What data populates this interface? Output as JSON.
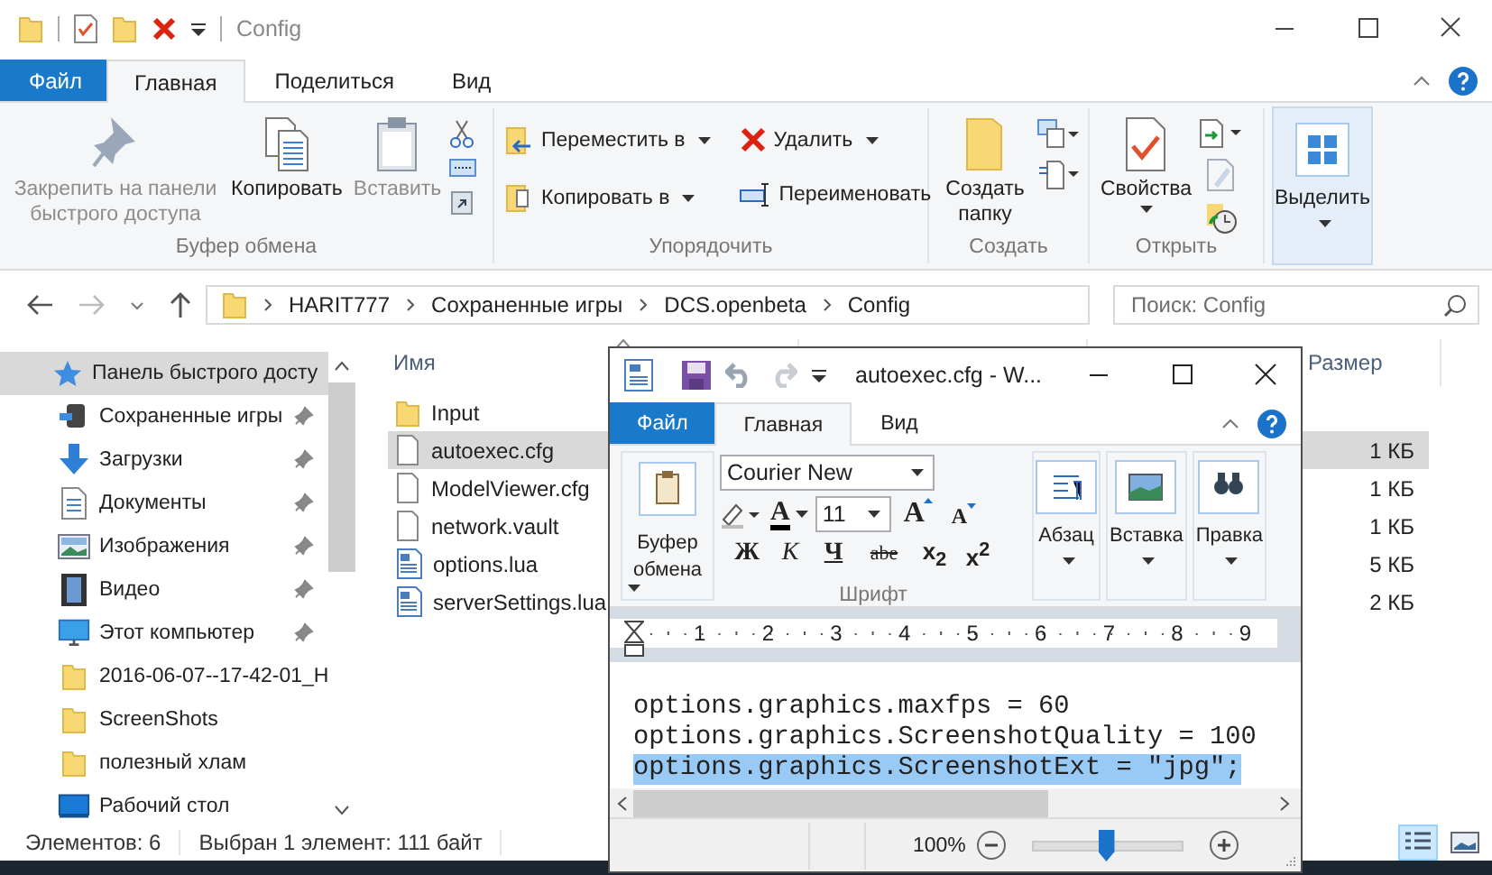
{
  "explorer": {
    "title": "Config",
    "tabs": [
      {
        "label": "Файл",
        "kind": "file",
        "selected": false
      },
      {
        "label": "Главная",
        "kind": "tab",
        "selected": true
      },
      {
        "label": "Поделиться",
        "kind": "tab",
        "selected": false
      },
      {
        "label": "Вид",
        "kind": "tab",
        "selected": false
      }
    ],
    "ribbon_groups": [
      {
        "label": "Буфер обмена",
        "buttons": [
          {
            "label": "Закрепить на панели быстрого доступа",
            "disabled": true
          },
          {
            "label": "Копировать",
            "disabled": false
          },
          {
            "label": "Вставить",
            "disabled": true
          }
        ]
      },
      {
        "label": "Упорядочить",
        "buttons": [
          {
            "label": "Переместить в",
            "dropdown": true
          },
          {
            "label": "Копировать в",
            "dropdown": true
          },
          {
            "label": "Удалить",
            "dropdown": true
          },
          {
            "label": "Переименовать",
            "dropdown": false
          }
        ]
      },
      {
        "label": "Создать",
        "buttons": [
          {
            "label": "Создать папку",
            "dropdown": false
          }
        ]
      },
      {
        "label": "Открыть",
        "buttons": [
          {
            "label": "Свойства",
            "dropdown": true
          }
        ]
      }
    ],
    "select_button": {
      "label": "Выделить",
      "dropdown": true
    },
    "breadcrumbs": [
      "HARIT777",
      "Сохраненные игры",
      "DCS.openbeta",
      "Config"
    ],
    "search": {
      "placeholder": "Поиск: Config"
    },
    "navigation": {
      "label": "Панель быстрого досту",
      "selected": true,
      "children": [
        {
          "label": "Сохраненные игры",
          "pinned": true,
          "selected": false
        },
        {
          "label": "Загрузки",
          "pinned": true,
          "selected": false
        },
        {
          "label": "Документы",
          "pinned": true,
          "selected": false
        },
        {
          "label": "Изображения",
          "pinned": true,
          "selected": false
        },
        {
          "label": "Видео",
          "pinned": true,
          "selected": false
        },
        {
          "label": "Этот компьютер",
          "pinned": true,
          "selected": false
        },
        {
          "label": "2016-06-07--17-42-01_H",
          "pinned": false,
          "selected": false
        },
        {
          "label": "ScreenShots",
          "pinned": false,
          "selected": false
        },
        {
          "label": "полезный хлам",
          "pinned": false,
          "selected": false
        },
        {
          "label": "Рабочий стол",
          "pinned": false,
          "selected": false
        }
      ]
    },
    "columns": {
      "name": "Имя",
      "size": "Размер"
    },
    "files": [
      {
        "name": "Input",
        "kind": "folder",
        "selected": false
      },
      {
        "name": "autoexec.cfg",
        "kind": "file",
        "size": "1 КБ",
        "selected": true
      },
      {
        "name": "ModelViewer.cfg",
        "kind": "file",
        "size": "1 КБ",
        "selected": false
      },
      {
        "name": "network.vault",
        "kind": "file",
        "size": "1 КБ",
        "selected": false
      },
      {
        "name": "options.lua",
        "kind": "document",
        "size": "5 КБ",
        "selected": false
      },
      {
        "name": "serverSettings.lua",
        "kind": "document",
        "size": "2 КБ",
        "selected": false
      }
    ],
    "status": [
      "Элементов: 6",
      "Выбран 1 элемент: 111 байт"
    ],
    "view_buttons": [
      {
        "kind": "details",
        "selected": true
      },
      {
        "kind": "icons",
        "selected": false
      }
    ]
  },
  "wordpad": {
    "title": "autoexec.cfg - W...",
    "tabs": [
      {
        "label": "Файл",
        "kind": "file",
        "selected": false
      },
      {
        "label": "Главная",
        "kind": "tab",
        "selected": true
      },
      {
        "label": "Вид",
        "kind": "tab",
        "selected": false
      }
    ],
    "clipboard_label": "Буфер обмена",
    "font_name": "Courier New",
    "font_size": "11",
    "font_color_button": "A",
    "size_buttons": [
      "A",
      "A"
    ],
    "format_buttons": [
      {
        "label": "Ж",
        "kind": "bold"
      },
      {
        "label": "К",
        "kind": "italic"
      },
      {
        "label": "Ч",
        "kind": "underline"
      },
      {
        "label": "abe",
        "kind": "strike"
      },
      {
        "label": "x$_{2}$",
        "kind": "subscript"
      },
      {
        "label": "x$^{2}$",
        "kind": "superscript"
      }
    ],
    "font_group_label": "Шрифт",
    "groups": [
      "Абзац",
      "Вставка",
      "Правка"
    ],
    "ruler": [
      "1",
      "2",
      "3",
      "4",
      "5",
      "6",
      "7",
      "8",
      "9"
    ],
    "lines": [
      {
        "text": "options.graphics.maxfps = 60",
        "selected": false
      },
      {
        "text": "options.graphics.ScreenshotQuality = 100",
        "selected": false
      },
      {
        "text": "options.graphics.ScreenshotExt = \"jpg\";",
        "selected": true
      }
    ],
    "zoom": {
      "reading": "100%",
      "level": 0.48
    }
  }
}
